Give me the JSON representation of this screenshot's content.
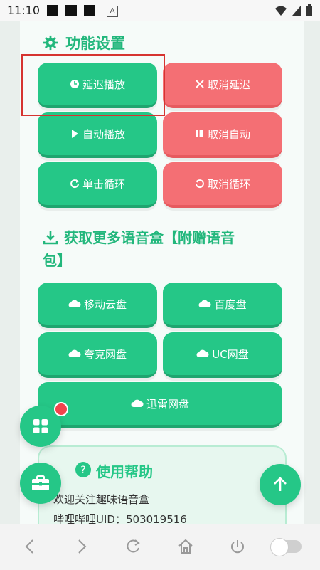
{
  "status_bar": {
    "time": "11:10"
  },
  "features": {
    "title": "功能设置",
    "buttons": [
      {
        "label": "延迟播放",
        "icon": "clock-icon"
      },
      {
        "label": "取消延迟",
        "icon": "close-icon"
      },
      {
        "label": "自动播放",
        "icon": "play-icon"
      },
      {
        "label": "取消自动",
        "icon": "pause-icon"
      },
      {
        "label": "单击循环",
        "icon": "loop-icon"
      },
      {
        "label": "取消循环",
        "icon": "undo-icon"
      }
    ]
  },
  "more": {
    "title_line1": "获取更多语音盒【附赠语音",
    "title_line2": "包】",
    "buttons": [
      {
        "label": "移动云盘",
        "icon": "cloud-icon"
      },
      {
        "label": "百度盘",
        "icon": "cloud-icon"
      },
      {
        "label": "夸克网盘",
        "icon": "cloud-icon"
      },
      {
        "label": "UC网盘",
        "icon": "cloud-icon"
      },
      {
        "label": "迅雷网盘",
        "icon": "cloud-icon"
      }
    ]
  },
  "help": {
    "title": "使用帮助",
    "line1": "欢迎关注趣味语音盒",
    "line2": "哔哩哔哩UID：503019516"
  }
}
